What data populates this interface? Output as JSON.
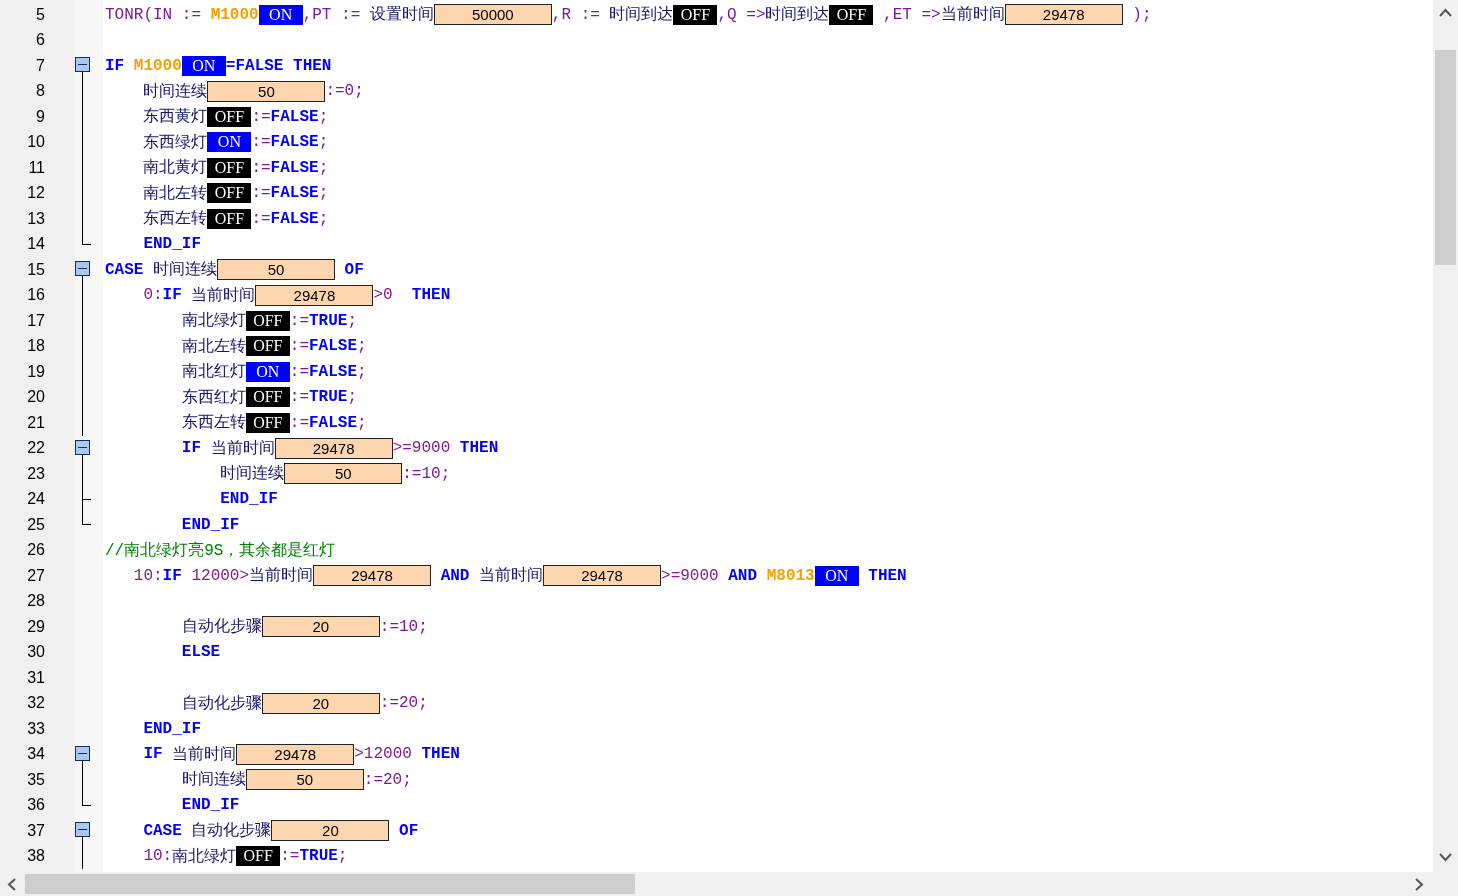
{
  "lines": [
    {
      "number": "5",
      "tokens": [
        {
          "kind": "op",
          "text": "TONR(IN := "
        },
        {
          "kind": "mem",
          "text": "M1000"
        },
        {
          "kind": "bool",
          "text": "ON",
          "on": true
        },
        {
          "kind": "op",
          "text": ",PT := "
        },
        {
          "kind": "id",
          "text": "设置时间"
        },
        {
          "kind": "val",
          "text": "50000"
        },
        {
          "kind": "op",
          "text": ",R := "
        },
        {
          "kind": "id",
          "text": "时间到达"
        },
        {
          "kind": "bool",
          "text": "OFF",
          "on": false
        },
        {
          "kind": "op",
          "text": ",Q =>"
        },
        {
          "kind": "id",
          "text": "时间到达"
        },
        {
          "kind": "bool",
          "text": "OFF",
          "on": false
        },
        {
          "kind": "op",
          "text": " ,ET =>"
        },
        {
          "kind": "id",
          "text": "当前时间"
        },
        {
          "kind": "val",
          "text": "29478"
        },
        {
          "kind": "op",
          "text": " );"
        }
      ]
    },
    {
      "number": "6"
    },
    {
      "number": "7",
      "kind": "open",
      "tokens": [
        {
          "kind": "kw",
          "text": "IF "
        },
        {
          "kind": "mem",
          "text": "M1000"
        },
        {
          "kind": "bool",
          "text": "ON",
          "on": true
        },
        {
          "kind": "kw",
          "text": "=FALSE THEN"
        }
      ]
    },
    {
      "number": "8",
      "kind": "line",
      "tokens": [
        {
          "kind": "id",
          "text": "    时间连续"
        },
        {
          "kind": "val",
          "text": "50"
        },
        {
          "kind": "op",
          "text": ":=0;"
        }
      ]
    },
    {
      "number": "9",
      "kind": "line",
      "tokens": [
        {
          "kind": "id",
          "text": "    东西黄灯"
        },
        {
          "kind": "bool",
          "text": "OFF",
          "on": false
        },
        {
          "kind": "op",
          "text": ":="
        },
        {
          "kind": "kw",
          "text": "FALSE"
        },
        {
          "kind": "op",
          "text": ";"
        }
      ]
    },
    {
      "number": "10",
      "kind": "line",
      "tokens": [
        {
          "kind": "id",
          "text": "    东西绿灯"
        },
        {
          "kind": "bool",
          "text": "ON",
          "on": true
        },
        {
          "kind": "op",
          "text": ":="
        },
        {
          "kind": "kw",
          "text": "FALSE"
        },
        {
          "kind": "op",
          "text": ";"
        }
      ]
    },
    {
      "number": "11",
      "kind": "line",
      "tokens": [
        {
          "kind": "id",
          "text": "    南北黄灯"
        },
        {
          "kind": "bool",
          "text": "OFF",
          "on": false
        },
        {
          "kind": "op",
          "text": ":="
        },
        {
          "kind": "kw",
          "text": "FALSE"
        },
        {
          "kind": "op",
          "text": ";"
        }
      ]
    },
    {
      "number": "12",
      "kind": "line",
      "tokens": [
        {
          "kind": "id",
          "text": "    南北左转"
        },
        {
          "kind": "bool",
          "text": "OFF",
          "on": false
        },
        {
          "kind": "op",
          "text": ":="
        },
        {
          "kind": "kw",
          "text": "FALSE"
        },
        {
          "kind": "op",
          "text": ";"
        }
      ]
    },
    {
      "number": "13",
      "kind": "line",
      "tokens": [
        {
          "kind": "id",
          "text": "    东西左转"
        },
        {
          "kind": "bool",
          "text": "OFF",
          "on": false
        },
        {
          "kind": "op",
          "text": ":="
        },
        {
          "kind": "kw",
          "text": "FALSE"
        },
        {
          "kind": "op",
          "text": ";"
        }
      ]
    },
    {
      "number": "14",
      "kind": "end",
      "tokens": [
        {
          "kind": "kw",
          "text": "    END_IF"
        }
      ]
    },
    {
      "number": "15",
      "kind": "open",
      "tokens": [
        {
          "kind": "kw",
          "text": "CASE "
        },
        {
          "kind": "id",
          "text": "时间连续"
        },
        {
          "kind": "val",
          "text": "50"
        },
        {
          "kind": "kw",
          "text": " OF"
        }
      ]
    },
    {
      "number": "16",
      "kind": "line",
      "tokens": [
        {
          "kind": "num",
          "text": "    0:"
        },
        {
          "kind": "kw",
          "text": "IF "
        },
        {
          "kind": "id",
          "text": "当前时间"
        },
        {
          "kind": "val",
          "text": "29478"
        },
        {
          "kind": "num",
          "text": ">0  "
        },
        {
          "kind": "kw",
          "text": "THEN"
        }
      ]
    },
    {
      "number": "17",
      "kind": "line",
      "tokens": [
        {
          "kind": "id",
          "text": "        南北绿灯"
        },
        {
          "kind": "bool",
          "text": "OFF",
          "on": false
        },
        {
          "kind": "op",
          "text": ":="
        },
        {
          "kind": "kw",
          "text": "TRUE"
        },
        {
          "kind": "op",
          "text": ";"
        }
      ]
    },
    {
      "number": "18",
      "kind": "line",
      "tokens": [
        {
          "kind": "id",
          "text": "        南北左转"
        },
        {
          "kind": "bool",
          "text": "OFF",
          "on": false
        },
        {
          "kind": "op",
          "text": ":="
        },
        {
          "kind": "kw",
          "text": "FALSE"
        },
        {
          "kind": "op",
          "text": ";"
        }
      ]
    },
    {
      "number": "19",
      "kind": "line",
      "tokens": [
        {
          "kind": "id",
          "text": "        南北红灯"
        },
        {
          "kind": "bool",
          "text": "ON",
          "on": true
        },
        {
          "kind": "op",
          "text": ":="
        },
        {
          "kind": "kw",
          "text": "FALSE"
        },
        {
          "kind": "op",
          "text": ";"
        }
      ]
    },
    {
      "number": "20",
      "kind": "line",
      "tokens": [
        {
          "kind": "id",
          "text": "        东西红灯"
        },
        {
          "kind": "bool",
          "text": "OFF",
          "on": false
        },
        {
          "kind": "op",
          "text": ":="
        },
        {
          "kind": "kw",
          "text": "TRUE"
        },
        {
          "kind": "op",
          "text": ";"
        }
      ]
    },
    {
      "number": "21",
      "kind": "line",
      "tokens": [
        {
          "kind": "id",
          "text": "        东西左转"
        },
        {
          "kind": "bool",
          "text": "OFF",
          "on": false
        },
        {
          "kind": "op",
          "text": ":="
        },
        {
          "kind": "kw",
          "text": "FALSE"
        },
        {
          "kind": "op",
          "text": ";"
        }
      ]
    },
    {
      "number": "22",
      "kind": "open",
      "tokens": [
        {
          "kind": "kw",
          "text": "        IF "
        },
        {
          "kind": "id",
          "text": "当前时间"
        },
        {
          "kind": "val",
          "text": "29478"
        },
        {
          "kind": "num",
          "text": ">=9000 "
        },
        {
          "kind": "kw",
          "text": "THEN"
        }
      ]
    },
    {
      "number": "23",
      "kind": "line",
      "tokens": [
        {
          "kind": "id",
          "text": "            时间连续"
        },
        {
          "kind": "val",
          "text": "50"
        },
        {
          "kind": "op",
          "text": ":=10;"
        }
      ]
    },
    {
      "number": "24",
      "kind": "tee",
      "tokens": [
        {
          "kind": "kw",
          "text": "            END_IF"
        }
      ]
    },
    {
      "number": "25",
      "kind": "end",
      "tokens": [
        {
          "kind": "kw",
          "text": "        END_IF"
        }
      ]
    },
    {
      "number": "26",
      "tokens": [
        {
          "kind": "cmt",
          "text": "//南北绿灯亮9S，其余都是红灯"
        }
      ]
    },
    {
      "number": "27",
      "tokens": [
        {
          "kind": "num",
          "text": "   10:"
        },
        {
          "kind": "kw",
          "text": "IF "
        },
        {
          "kind": "num",
          "text": "12000>"
        },
        {
          "kind": "id",
          "text": "当前时间"
        },
        {
          "kind": "val",
          "text": "29478"
        },
        {
          "kind": "kw",
          "text": " AND "
        },
        {
          "kind": "id",
          "text": "当前时间"
        },
        {
          "kind": "val",
          "text": "29478"
        },
        {
          "kind": "num",
          "text": ">=9000 "
        },
        {
          "kind": "kw",
          "text": "AND "
        },
        {
          "kind": "mem",
          "text": "M8013"
        },
        {
          "kind": "bool",
          "text": "ON",
          "on": true
        },
        {
          "kind": "kw",
          "text": " THEN"
        }
      ]
    },
    {
      "number": "28"
    },
    {
      "number": "29",
      "tokens": [
        {
          "kind": "id",
          "text": "        自动化步骤"
        },
        {
          "kind": "val",
          "text": "20"
        },
        {
          "kind": "op",
          "text": ":=10;"
        }
      ]
    },
    {
      "number": "30",
      "tokens": [
        {
          "kind": "kw",
          "text": "        ELSE"
        }
      ]
    },
    {
      "number": "31"
    },
    {
      "number": "32",
      "tokens": [
        {
          "kind": "id",
          "text": "        自动化步骤"
        },
        {
          "kind": "val",
          "text": "20"
        },
        {
          "kind": "op",
          "text": ":=20;"
        }
      ]
    },
    {
      "number": "33",
      "tokens": [
        {
          "kind": "kw",
          "text": "    END_IF"
        }
      ]
    },
    {
      "number": "34",
      "kind": "open",
      "tokens": [
        {
          "kind": "kw",
          "text": "    IF "
        },
        {
          "kind": "id",
          "text": "当前时间"
        },
        {
          "kind": "val",
          "text": "29478"
        },
        {
          "kind": "num",
          "text": ">12000 "
        },
        {
          "kind": "kw",
          "text": "THEN"
        }
      ]
    },
    {
      "number": "35",
      "kind": "line",
      "tokens": [
        {
          "kind": "id",
          "text": "        时间连续"
        },
        {
          "kind": "val",
          "text": "50"
        },
        {
          "kind": "op",
          "text": ":=20;"
        }
      ]
    },
    {
      "number": "36",
      "kind": "end",
      "tokens": [
        {
          "kind": "kw",
          "text": "        END_IF"
        }
      ]
    },
    {
      "number": "37",
      "kind": "open",
      "tokens": [
        {
          "kind": "kw",
          "text": "    CASE "
        },
        {
          "kind": "id",
          "text": "自动化步骤"
        },
        {
          "kind": "val",
          "text": "20"
        },
        {
          "kind": "kw",
          "text": " OF"
        }
      ]
    },
    {
      "number": "38",
      "kind": "line",
      "tokens": [
        {
          "kind": "num",
          "text": "    10:"
        },
        {
          "kind": "id",
          "text": "南北绿灯"
        },
        {
          "kind": "bool",
          "text": "OFF",
          "on": false
        },
        {
          "kind": "op",
          "text": ":="
        },
        {
          "kind": "kw",
          "text": "TRUE"
        },
        {
          "kind": "op",
          "text": ";"
        }
      ]
    }
  ]
}
